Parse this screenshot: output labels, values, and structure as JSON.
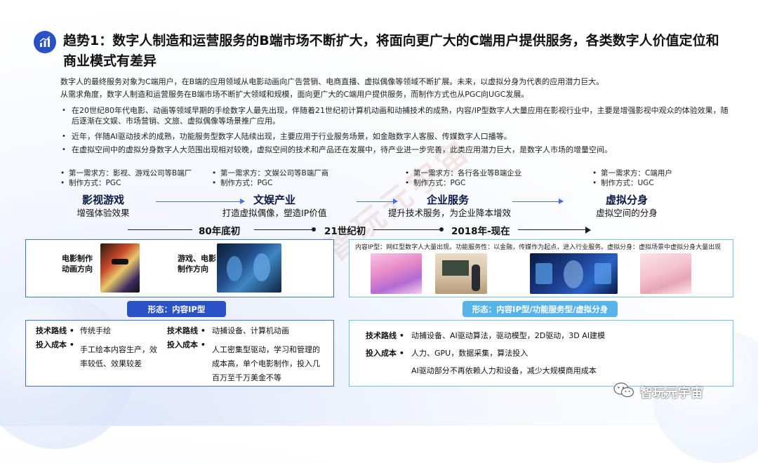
{
  "header": {
    "title": "趋势1：数字人制造和运营服务的B端市场不断扩大，将面向更广大的C端用户提供服务，各类数字人价值定位和商业模式有差异"
  },
  "intro": {
    "line1": "数字人的最终服务对象为C端用户，在B端的应用领域从电影动画向广告营销、电商直播、虚拟偶像等领域不断扩展。未来，以虚拟分身为代表的应用潜力巨大。",
    "line2": "从需求角度，数字人制造和运营服务在B端市场不断扩大领域和规模，面向更广大的C端用户提供服务，而制作方式也从PGC向UGC发展。",
    "bullets": [
      "在20世纪80年代电影、动画等领域早期的手绘数字人最先出现，伴随着21世纪初计算机动画和动捕技术的成熟，内容/IP型数字人大量应用在影视行业中，主要是增强影视中观众的体验效果，随后逐渐在文娱、市场营销、文旅、虚拟偶像等场景推广应用。",
      "近年，伴随AI驱动技术的成熟，功能服务型数字人陆续出现，主要应用于行业服务场景，如金融数字人客服、传媒数字人口播等。",
      "在虚拟空间中的虚拟分身数字人大范围出现相对较晚，虚拟空间的技术和产品还在发展中，待产业进一步完善，此类应用潜力巨大，是数字人市场的增量空间。"
    ]
  },
  "stages": [
    {
      "demand": "第一需求方：影视、游戏公司等B端厂",
      "method": "制作方式：PGC",
      "title": "影视游戏",
      "sub": "增强体验效果"
    },
    {
      "demand": "第一需求方：文娱公司等B端厂商",
      "method": "制作方式：PGC",
      "title": "文娱产业",
      "sub": "打造虚拟偶像，塑造IP价值"
    },
    {
      "demand": "第一需求方：各行各业等B端企业",
      "method": "制作方式：PGC",
      "title": "企业服务",
      "sub": "提升技术服务，为企业降本增效"
    },
    {
      "demand": "第一需求方：C端用户",
      "method": "制作方式：UGC",
      "title": "虚拟分身",
      "sub": "虚拟空间的分身"
    }
  ],
  "timeline": {
    "labels": [
      "80年底初",
      "21世纪初",
      "2018年-现在"
    ]
  },
  "left_panel": {
    "img1_label": "电影制作\n动画方向",
    "img2_label": "游戏、电影\n制作方向",
    "form_pill": "形态：内容IP型",
    "col1": {
      "route_label": "技术路线",
      "route_value": "传统手绘",
      "cost_label": "投入成本",
      "cost_value": "手工绘本内容生产，效率较低、效果较差"
    },
    "col2": {
      "route_label": "技术路线",
      "route_value": "动捕设备、计算机动画",
      "cost_label": "投入成本",
      "cost_value": "人工密集型驱动，学习和管理的成本高，单个电影制作，投入几百万至千万美金不等"
    }
  },
  "right_panel": {
    "caption": "内容IP型：网红型数字人大量出现。功能服务性：以金融，传媒作为起点，进入行业服务。虚拟分身：虚拟场景中虚拟分身大量出现",
    "form_pill": "形态：内容IP型/功能服务型/虚拟分身",
    "route_label": "技术路线",
    "route_value": "动捕设备、AI驱动算法，驱动模型，2D驱动，3D AI建模",
    "cost_label": "投入成本",
    "cost_value": "人力、GPU，数据采集，算法投入",
    "note": "AI驱动部分不再依赖人力和设备，减少大规模商用成本"
  },
  "branding": {
    "logo_text": "智玩元宇宙"
  },
  "colors": {
    "primary": "#2b51c7",
    "accent_light": "#56b4ea",
    "panel_border": "#3f6fe0"
  }
}
